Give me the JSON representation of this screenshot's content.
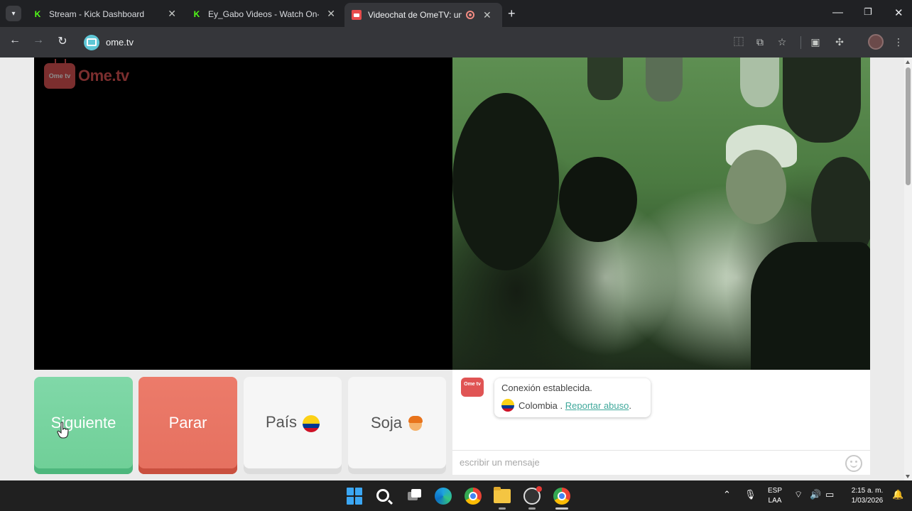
{
  "browser": {
    "tabs": [
      {
        "title": "Stream - Kick Dashboard",
        "favicon": "kick-icon"
      },
      {
        "title": "Ey_Gabo Videos - Watch On-De",
        "favicon": "kick-icon"
      },
      {
        "title": "Videochat de OmeTV: una",
        "favicon": "ometv-icon",
        "active": true
      }
    ],
    "new_tab_symbol": "+",
    "close_symbol": "✕",
    "url": "ome.tv"
  },
  "site": {
    "logo_text": "Ome.tv",
    "logo_badge_text": "Ome tv"
  },
  "controls": {
    "next_label": "Siguiente",
    "stop_label": "Parar",
    "country_label": "País",
    "country_flag": "colombia-flag",
    "gender_label": "Soja",
    "gender_icon": "boy-face-icon",
    "colors": {
      "next": "#6fcf97",
      "stop": "#e5705f",
      "neutral": "#f6f6f6"
    }
  },
  "chat": {
    "status_message": "Conexión establecida.",
    "country_name": "Colombia",
    "separator": " . ",
    "report_link": "Reportar abuso",
    "report_suffix": ".",
    "input_placeholder": "escribir un mensaje"
  },
  "taskbar": {
    "language_top": "ESP",
    "language_bottom": "LAA",
    "time": "2:15 a. m.",
    "date": "1/03/2026"
  }
}
